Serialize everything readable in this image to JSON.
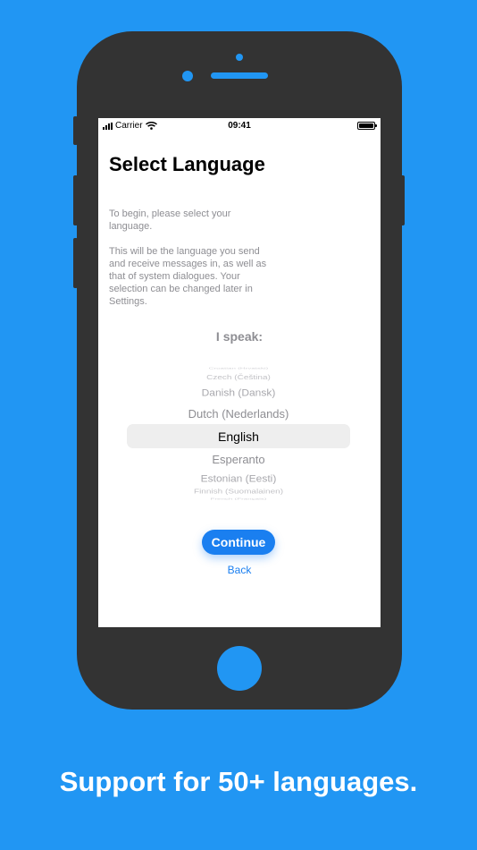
{
  "colors": {
    "background": "#2196f3",
    "phone_body": "#333333",
    "accent": "#1a7ff0",
    "secondary_text": "#8e8e93",
    "picker_selection": "#eeeeee"
  },
  "status_bar": {
    "carrier": "Carrier",
    "time": "09:41",
    "signal_icon": "signal-bars-icon",
    "wifi_icon": "wifi-icon",
    "battery_icon": "battery-icon"
  },
  "screen": {
    "title": "Select Language",
    "intro": "To begin, please select your language.",
    "description": "This will be the language you send and receive messages in, as well as that of system dialogues. Your selection can be changed later in Settings.",
    "prompt": "I speak:",
    "picker": {
      "options": [
        "Croatian (Hrvatski)",
        "Czech (Čeština)",
        "Danish (Dansk)",
        "Dutch (Nederlands)",
        "English",
        "Esperanto",
        "Estonian (Eesti)",
        "Finnish (Suomalainen)",
        "French (Français)"
      ],
      "selected": "English"
    },
    "continue_label": "Continue",
    "back_label": "Back"
  },
  "caption": "Support for 50+ languages."
}
